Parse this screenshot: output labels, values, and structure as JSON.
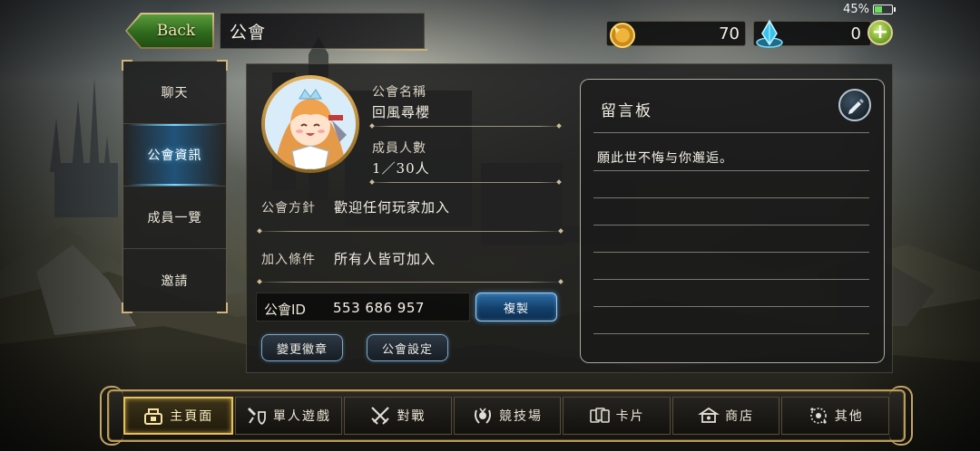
{
  "status": {
    "battery_percent": "45%",
    "battery_level": 0.45
  },
  "header": {
    "back_label": "Back",
    "title": "公會"
  },
  "currency": {
    "gold": "70",
    "crystal": "0"
  },
  "sidebar": {
    "items": [
      {
        "label": "聊天",
        "active": false
      },
      {
        "label": "公會資訊",
        "active": true
      },
      {
        "label": "成員一覽",
        "active": false
      },
      {
        "label": "邀請",
        "active": false
      }
    ]
  },
  "guild": {
    "name_label": "公會名稱",
    "name": "回風尋櫻",
    "members_label": "成員人數",
    "members": "1／30人",
    "policy_label": "公會方針",
    "policy": "歡迎任何玩家加入",
    "condition_label": "加入條件",
    "condition": "所有人皆可加入",
    "id_label": "公會ID",
    "id_value": "553 686 957",
    "copy_label": "複製",
    "change_emblem_label": "變更徽章",
    "settings_label": "公會設定"
  },
  "board": {
    "title": "留言板",
    "message": "願此世不悔与你邂逅。"
  },
  "bottom_nav": {
    "items": [
      {
        "label": "主頁面",
        "icon": "home-icon",
        "active": true
      },
      {
        "label": "單人遊戲",
        "icon": "sword-shield-icon",
        "active": false
      },
      {
        "label": "對戰",
        "icon": "crossed-swords-icon",
        "active": false
      },
      {
        "label": "競技場",
        "icon": "arena-wreath-icon",
        "active": false
      },
      {
        "label": "卡片",
        "icon": "cards-icon",
        "active": false
      },
      {
        "label": "商店",
        "icon": "shop-icon",
        "active": false
      },
      {
        "label": "其他",
        "icon": "other-icon",
        "active": false
      }
    ]
  },
  "colors": {
    "accent_blue": "#2c6fa8",
    "gold_trim": "#e6c15a",
    "back_green": "#2f6a1d"
  }
}
